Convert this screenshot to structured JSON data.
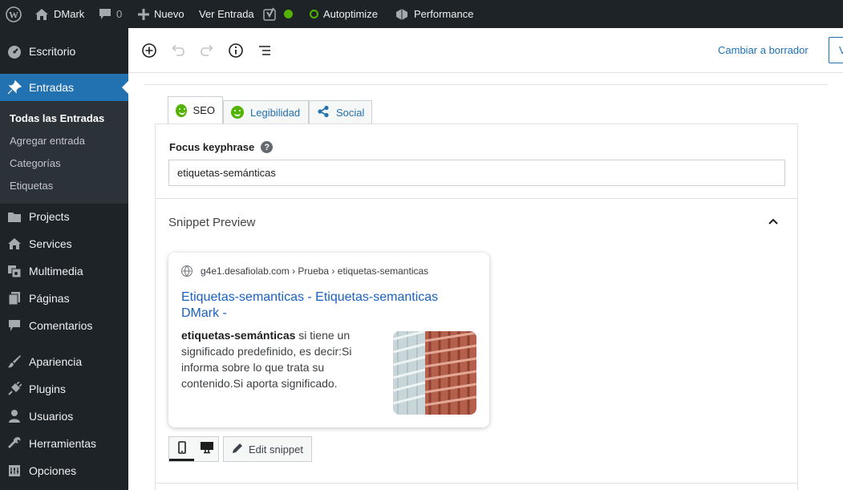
{
  "adminbar": {
    "site_name": "DMark",
    "comments_count": "0",
    "new_label": "Nuevo",
    "view_post_label": "Ver Entrada",
    "autoptimize_label": "Autoptimize",
    "performance_label": "Performance"
  },
  "sidebar": {
    "items": [
      {
        "label": "Escritorio",
        "icon": "dashboard-icon"
      },
      {
        "label": "Entradas",
        "icon": "pin-icon"
      },
      {
        "label": "Projects",
        "icon": "folder-icon"
      },
      {
        "label": "Services",
        "icon": "home-icon"
      },
      {
        "label": "Multimedia",
        "icon": "media-icon"
      },
      {
        "label": "Páginas",
        "icon": "pages-icon"
      },
      {
        "label": "Comentarios",
        "icon": "comment-icon"
      },
      {
        "label": "Apariencia",
        "icon": "brush-icon"
      },
      {
        "label": "Plugins",
        "icon": "plug-icon"
      },
      {
        "label": "Usuarios",
        "icon": "user-icon"
      },
      {
        "label": "Herramientas",
        "icon": "wrench-icon"
      },
      {
        "label": "Opciones",
        "icon": "settings-icon"
      }
    ],
    "submenu": [
      "Todas las Entradas",
      "Agregar entrada",
      "Categorías",
      "Etiquetas"
    ]
  },
  "header": {
    "save_draft_label": "Cambiar a borrador",
    "preview_label": "V"
  },
  "yoast": {
    "tabs": [
      "SEO",
      "Legibilidad",
      "Social"
    ],
    "focus_keyphrase_label": "Focus keyphrase",
    "focus_keyphrase_value": "etiquetas-semánticas",
    "snippet_preview_title": "Snippet Preview",
    "edit_snippet_label": "Edit snippet",
    "colors": {
      "good": "#52b400",
      "link": "#2271b1"
    }
  },
  "serp": {
    "breadcrumb": "g4e1.desafiolab.com › Prueba › etiquetas-semanticas",
    "title": "Etiquetas-semanticas - Etiquetas-semanticas DMark -",
    "desc_keyword": "etiquetas-semánticas",
    "desc_rest": " si tiene un significado predefinido, es decir:Si informa sobre lo que trata su contenido.Si aporta significado."
  }
}
